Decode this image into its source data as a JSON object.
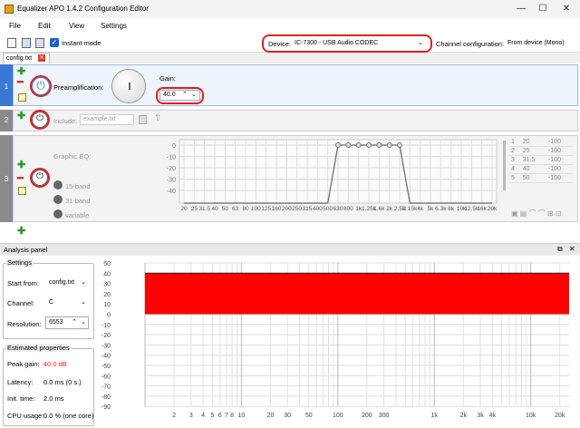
{
  "window": {
    "title": "Equalizer APO 1.4.2 Configuration Editor",
    "minimize": "—",
    "maximize": "☐",
    "close": "✕"
  },
  "menu": [
    "File",
    "Edit",
    "View",
    "Settings"
  ],
  "toolbar": {
    "instant_mode": "Instant mode",
    "device_label": "Device:",
    "device_value": "IC-7300 - USB Audio CODEC",
    "channel_label": "Channel configuration:",
    "channel_value": "From device (Mono)"
  },
  "tab": {
    "name": "config.txt"
  },
  "rows": [
    {
      "num": "1",
      "label": "Preamplification:",
      "gain_label": "Gain:",
      "gain_value": "40.0"
    },
    {
      "num": "2",
      "include_label": "Include:",
      "include_placeholder": "example.txt"
    },
    {
      "num": "3",
      "label": "Graphic EQ:",
      "options": [
        "15-band",
        "31-band",
        "variable"
      ],
      "y_ticks": [
        "0",
        "-10",
        "-20",
        "-30",
        "-40"
      ],
      "x_ticks": [
        "20",
        "25",
        "31.5",
        "40",
        "50",
        "63",
        "80",
        "100",
        "125",
        "160",
        "200",
        "250",
        "315",
        "400",
        "500",
        "630",
        "800",
        "1k",
        "1.25k",
        "1.6k",
        "2k",
        "2.5k",
        "3.15k",
        "4k",
        "5k",
        "6.3k",
        "8k",
        "10k",
        "12.5k",
        "16k",
        "20k"
      ],
      "table": [
        [
          "1",
          "20",
          "-100"
        ],
        [
          "2",
          "25",
          "-100"
        ],
        [
          "3",
          "31.5",
          "-100"
        ],
        [
          "4",
          "40",
          "-100"
        ],
        [
          "5",
          "50",
          "-100"
        ]
      ]
    }
  ],
  "analysis": {
    "title": "Analysis panel",
    "settings_title": "Settings",
    "start_from_label": "Start from:",
    "start_from_value": "config.txt",
    "channel_label": "Channel:",
    "channel_value": "C",
    "resolution_label": "Resolution:",
    "resolution_value": "6553",
    "estimated_title": "Estimated properties",
    "peak_label": "Peak gain:",
    "peak_value": "40.0 dB",
    "latency_label": "Latency:",
    "latency_value": "0.0 ms (0 s.)",
    "init_label": "Init. time:",
    "init_value": "2.0 ms",
    "cpu_label": "CPU usage:",
    "cpu_value": "0.0 % (one core)",
    "y_ticks": [
      "50",
      "40",
      "30",
      "20",
      "10",
      "0",
      "-10",
      "-20",
      "-30",
      "-40",
      "-50",
      "-60",
      "-70",
      "-80",
      "-90"
    ],
    "x_ticks": [
      "2",
      "3",
      "4",
      "5",
      "6",
      "7",
      "8",
      "10",
      "20",
      "30",
      "50",
      "100",
      "200",
      "300",
      "1k",
      "2k",
      "3k",
      "4k",
      "10k",
      "20k"
    ]
  },
  "colors": {
    "accent": "#3a78d6",
    "red": "#ff0000",
    "row_bar_gray": "#8a8a8a"
  }
}
